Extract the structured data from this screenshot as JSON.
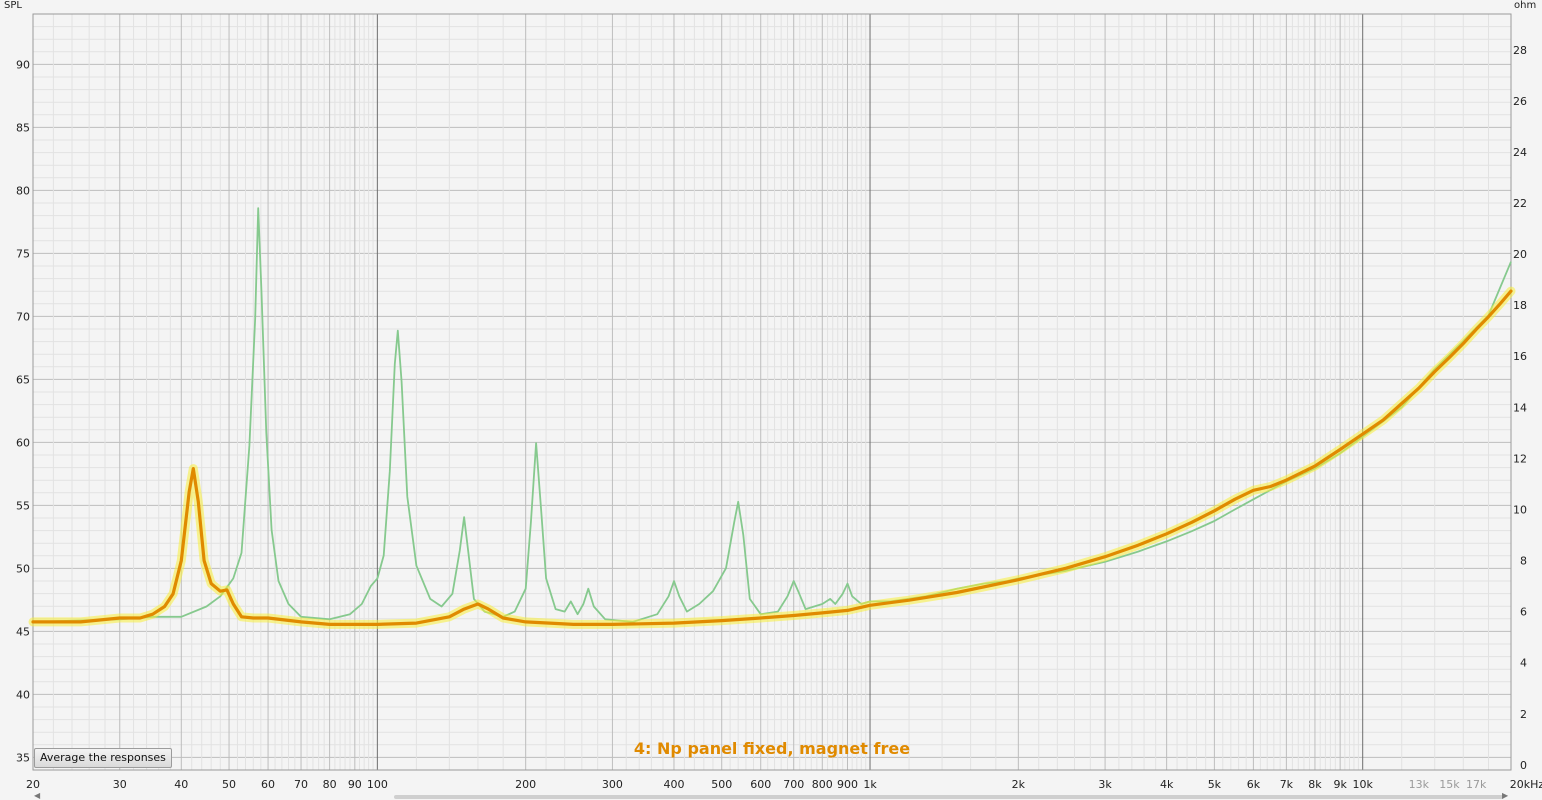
{
  "y_left_unit": "SPL",
  "y_right_unit": "ohm",
  "x_unit": "kHz",
  "average_button_label": "Average the responses",
  "colors": {
    "background": "#f4f4f4",
    "grid_minor": "#e2e2e2",
    "grid_major": "#bdbdbd",
    "grid_decade": "#6e6e6e",
    "measurement": "#e08a00",
    "measurement_glow": "#f8ee3a",
    "reference": "#86c98e"
  },
  "chart_data": {
    "type": "line",
    "title": "",
    "x_scale": "log",
    "xlim": [
      20,
      20000
    ],
    "y_left_label": "SPL",
    "y_left_lim": [
      34,
      94
    ],
    "y_left_ticks": [
      35,
      40,
      45,
      50,
      55,
      60,
      65,
      70,
      75,
      80,
      85,
      90
    ],
    "y_right_label": "ohm",
    "y_right_lim": [
      -0.2,
      29.4
    ],
    "y_right_ticks": [
      0,
      2,
      4,
      6,
      8,
      10,
      12,
      14,
      16,
      18,
      20,
      22,
      24,
      26,
      28
    ],
    "x_ticks": [
      {
        "v": 20,
        "label": "20"
      },
      {
        "v": 30,
        "label": "30"
      },
      {
        "v": 40,
        "label": "40"
      },
      {
        "v": 50,
        "label": "50"
      },
      {
        "v": 60,
        "label": "60"
      },
      {
        "v": 70,
        "label": "70"
      },
      {
        "v": 80,
        "label": "80"
      },
      {
        "v": 90,
        "label": "90"
      },
      {
        "v": 100,
        "label": "100"
      },
      {
        "v": 200,
        "label": "200"
      },
      {
        "v": 300,
        "label": "300"
      },
      {
        "v": 400,
        "label": "400"
      },
      {
        "v": 500,
        "label": "500"
      },
      {
        "v": 600,
        "label": "600"
      },
      {
        "v": 700,
        "label": "700"
      },
      {
        "v": 800,
        "label": "800"
      },
      {
        "v": 900,
        "label": "900"
      },
      {
        "v": 1000,
        "label": "1k"
      },
      {
        "v": 2000,
        "label": "2k"
      },
      {
        "v": 3000,
        "label": "3k"
      },
      {
        "v": 4000,
        "label": "4k"
      },
      {
        "v": 5000,
        "label": "5k"
      },
      {
        "v": 6000,
        "label": "6k"
      },
      {
        "v": 7000,
        "label": "7k"
      },
      {
        "v": 8000,
        "label": "8k"
      },
      {
        "v": 9000,
        "label": "9k"
      },
      {
        "v": 10000,
        "label": "10k"
      },
      {
        "v": 13000,
        "label": "13k",
        "minor": true
      },
      {
        "v": 15000,
        "label": "15k",
        "minor": true
      },
      {
        "v": 17000,
        "label": "17k",
        "minor": true
      },
      {
        "v": 20000,
        "label": "20kHz"
      }
    ],
    "grid": true,
    "legend": "bottom-center",
    "series": [
      {
        "name": "4: Np panel fixed, magnet free",
        "axis": "ohm",
        "color": "#e08a00",
        "points": [
          [
            20,
            5.6
          ],
          [
            25,
            5.6
          ],
          [
            30,
            5.75
          ],
          [
            33,
            5.75
          ],
          [
            35,
            5.9
          ],
          [
            37,
            6.2
          ],
          [
            38.5,
            6.7
          ],
          [
            40,
            8.0
          ],
          [
            41.5,
            10.7
          ],
          [
            42.3,
            11.6
          ],
          [
            43.3,
            10.3
          ],
          [
            44.5,
            8.0
          ],
          [
            46,
            7.1
          ],
          [
            48,
            6.8
          ],
          [
            49.5,
            6.85
          ],
          [
            51,
            6.3
          ],
          [
            53,
            5.8
          ],
          [
            56,
            5.75
          ],
          [
            60,
            5.75
          ],
          [
            70,
            5.6
          ],
          [
            80,
            5.5
          ],
          [
            100,
            5.5
          ],
          [
            120,
            5.55
          ],
          [
            140,
            5.8
          ],
          [
            150,
            6.1
          ],
          [
            160,
            6.3
          ],
          [
            168,
            6.1
          ],
          [
            180,
            5.75
          ],
          [
            200,
            5.6
          ],
          [
            250,
            5.5
          ],
          [
            300,
            5.5
          ],
          [
            400,
            5.55
          ],
          [
            500,
            5.65
          ],
          [
            600,
            5.75
          ],
          [
            700,
            5.85
          ],
          [
            800,
            5.95
          ],
          [
            900,
            6.05
          ],
          [
            1000,
            6.25
          ],
          [
            1200,
            6.45
          ],
          [
            1500,
            6.75
          ],
          [
            2000,
            7.25
          ],
          [
            2500,
            7.7
          ],
          [
            3000,
            8.15
          ],
          [
            3500,
            8.6
          ],
          [
            4000,
            9.05
          ],
          [
            4500,
            9.5
          ],
          [
            5000,
            9.95
          ],
          [
            5500,
            10.4
          ],
          [
            6000,
            10.75
          ],
          [
            6500,
            10.9
          ],
          [
            7000,
            11.15
          ],
          [
            8000,
            11.7
          ],
          [
            9000,
            12.35
          ],
          [
            10000,
            12.95
          ],
          [
            11000,
            13.5
          ],
          [
            12000,
            14.15
          ],
          [
            13000,
            14.75
          ],
          [
            14000,
            15.4
          ],
          [
            15000,
            15.95
          ],
          [
            16000,
            16.5
          ],
          [
            17000,
            17.05
          ],
          [
            18000,
            17.55
          ],
          [
            19000,
            18.05
          ],
          [
            20000,
            18.55
          ]
        ]
      },
      {
        "name": "",
        "axis": "ohm",
        "color": "#86c98e",
        "points": [
          [
            20,
            5.6
          ],
          [
            30,
            5.7
          ],
          [
            35,
            5.8
          ],
          [
            40,
            5.8
          ],
          [
            45,
            6.2
          ],
          [
            48,
            6.6
          ],
          [
            51,
            7.3
          ],
          [
            53,
            8.3
          ],
          [
            55,
            12.5
          ],
          [
            56.5,
            17.5
          ],
          [
            57.3,
            21.8
          ],
          [
            58.2,
            18.5
          ],
          [
            59.5,
            13.0
          ],
          [
            61,
            9.2
          ],
          [
            63,
            7.2
          ],
          [
            66,
            6.3
          ],
          [
            70,
            5.8
          ],
          [
            80,
            5.7
          ],
          [
            88,
            5.9
          ],
          [
            93,
            6.3
          ],
          [
            97,
            7.0
          ],
          [
            100,
            7.3
          ],
          [
            103,
            8.2
          ],
          [
            106,
            11.5
          ],
          [
            108.5,
            15.7
          ],
          [
            110,
            17.0
          ],
          [
            112,
            15.0
          ],
          [
            115,
            10.5
          ],
          [
            120,
            7.8
          ],
          [
            128,
            6.5
          ],
          [
            135,
            6.2
          ],
          [
            142,
            6.7
          ],
          [
            147,
            8.4
          ],
          [
            150,
            9.7
          ],
          [
            153,
            8.3
          ],
          [
            157,
            6.5
          ],
          [
            165,
            6.0
          ],
          [
            180,
            5.8
          ],
          [
            190,
            6.0
          ],
          [
            200,
            6.9
          ],
          [
            205,
            9.5
          ],
          [
            210,
            12.6
          ],
          [
            215,
            10.0
          ],
          [
            220,
            7.3
          ],
          [
            230,
            6.1
          ],
          [
            240,
            6.0
          ],
          [
            247,
            6.4
          ],
          [
            255,
            5.9
          ],
          [
            262,
            6.3
          ],
          [
            268,
            6.9
          ],
          [
            275,
            6.2
          ],
          [
            290,
            5.7
          ],
          [
            330,
            5.6
          ],
          [
            370,
            5.9
          ],
          [
            390,
            6.6
          ],
          [
            400,
            7.2
          ],
          [
            410,
            6.6
          ],
          [
            425,
            6.0
          ],
          [
            450,
            6.3
          ],
          [
            480,
            6.8
          ],
          [
            510,
            7.7
          ],
          [
            530,
            9.5
          ],
          [
            540,
            10.3
          ],
          [
            553,
            9.0
          ],
          [
            570,
            6.5
          ],
          [
            600,
            5.9
          ],
          [
            650,
            6.0
          ],
          [
            680,
            6.6
          ],
          [
            700,
            7.2
          ],
          [
            715,
            6.8
          ],
          [
            740,
            6.1
          ],
          [
            800,
            6.3
          ],
          [
            830,
            6.5
          ],
          [
            850,
            6.3
          ],
          [
            880,
            6.7
          ],
          [
            900,
            7.1
          ],
          [
            920,
            6.6
          ],
          [
            960,
            6.3
          ],
          [
            1000,
            6.4
          ],
          [
            1100,
            6.4
          ],
          [
            1300,
            6.6
          ],
          [
            1500,
            6.9
          ],
          [
            1700,
            7.1
          ],
          [
            1900,
            7.2
          ],
          [
            2000,
            7.3
          ],
          [
            2500,
            7.6
          ],
          [
            3000,
            7.95
          ],
          [
            3500,
            8.35
          ],
          [
            4000,
            8.75
          ],
          [
            4500,
            9.15
          ],
          [
            5000,
            9.55
          ],
          [
            5500,
            10.0
          ],
          [
            6000,
            10.4
          ],
          [
            7000,
            11.1
          ],
          [
            8000,
            11.6
          ],
          [
            9000,
            12.2
          ],
          [
            10000,
            12.85
          ],
          [
            12000,
            14.0
          ],
          [
            14000,
            15.5
          ],
          [
            16000,
            16.6
          ],
          [
            18000,
            17.6
          ],
          [
            20000,
            19.7
          ]
        ]
      }
    ]
  }
}
